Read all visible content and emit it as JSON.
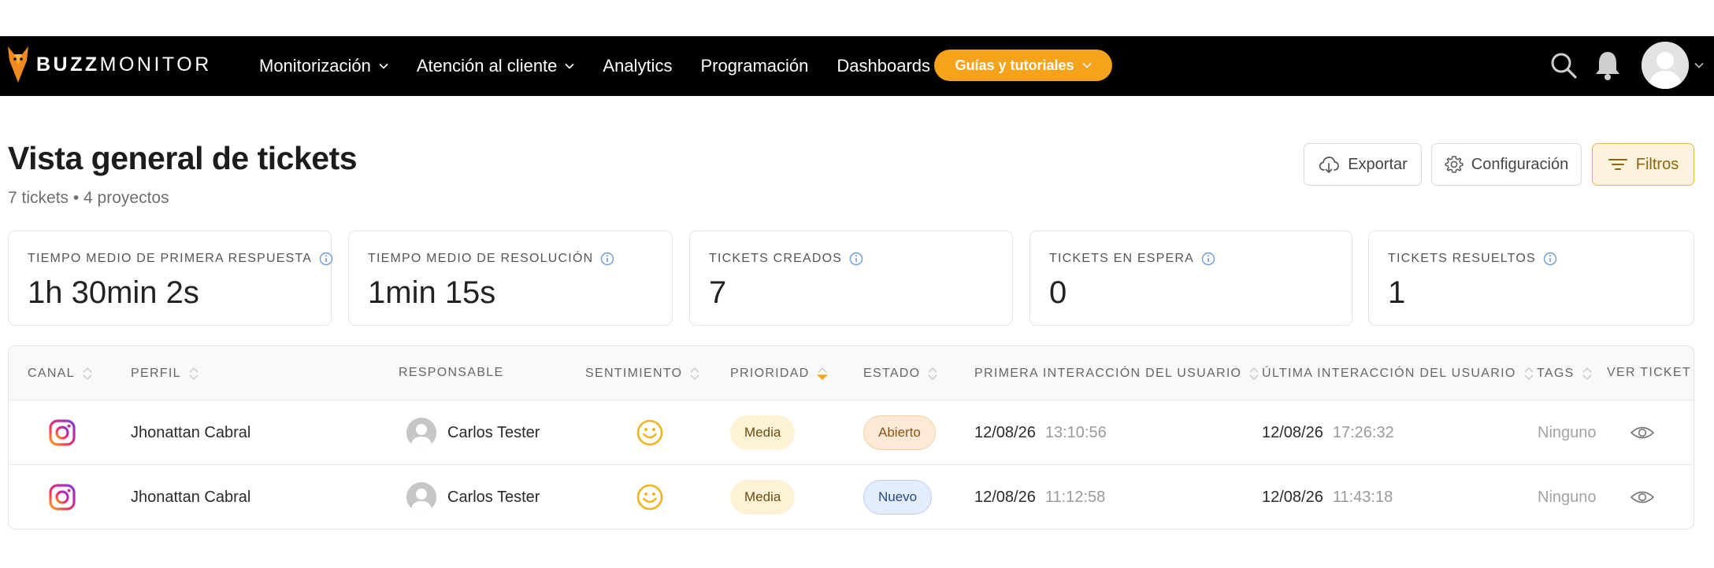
{
  "brand": {
    "bold": "BUZZ",
    "light": "MONITOR"
  },
  "nav": {
    "items": [
      {
        "label": "Monitorización",
        "has_dropdown": true
      },
      {
        "label": "Atención al cliente",
        "has_dropdown": true
      },
      {
        "label": "Analytics",
        "has_dropdown": false
      },
      {
        "label": "Programación",
        "has_dropdown": false
      },
      {
        "label": "Dashboards",
        "has_dropdown": false
      }
    ],
    "guides_label": "Guías y tutoriales",
    "icons": [
      "search-icon",
      "bell-icon",
      "user-avatar",
      "chevron-down-icon"
    ]
  },
  "header": {
    "title": "Vista general de tickets",
    "subtitle": "7 tickets • 4 proyectos",
    "buttons": {
      "export": "Exportar",
      "config": "Configuración",
      "filters": "Filtros"
    }
  },
  "stats": [
    {
      "label": "TIEMPO MEDIO DE PRIMERA RESPUESTA",
      "value": "1h 30min 2s"
    },
    {
      "label": "TIEMPO MEDIO DE RESOLUCIÓN",
      "value": "1min 15s"
    },
    {
      "label": "TICKETS CREADOS",
      "value": "7"
    },
    {
      "label": "TICKETS EN ESPERA",
      "value": "0"
    },
    {
      "label": "TICKETS RESUELTOS",
      "value": "1"
    }
  ],
  "table": {
    "columns": [
      "CANAL",
      "PERFIL",
      "RESPONSABLE",
      "SENTIMIENTO",
      "PRIORIDAD",
      "ESTADO",
      "PRIMERA INTERACCIÓN DEL USUARIO",
      "ÚLTIMA INTERACCIÓN DEL USUARIO",
      "TAGS",
      "VER TICKET"
    ],
    "active_sort_column": "PRIORIDAD",
    "rows": [
      {
        "channel": "instagram-icon",
        "profile": "Jhonattan Cabral",
        "agent": "Carlos Tester",
        "sentiment": "smile-icon",
        "priority": "Media",
        "status": "Abierto",
        "first_date": "12/08/26",
        "first_time": "13:10:56",
        "last_date": "12/08/26",
        "last_time": "17:26:32",
        "tags": "Ninguno"
      },
      {
        "channel": "instagram-icon",
        "profile": "Jhonattan Cabral",
        "agent": "Carlos Tester",
        "sentiment": "smile-icon",
        "priority": "Media",
        "status": "Nuevo",
        "first_date": "12/08/26",
        "first_time": "11:12:58",
        "last_date": "12/08/26",
        "last_time": "11:43:18",
        "tags": "Ninguno"
      }
    ]
  },
  "colors": {
    "accent": "#f6a31b",
    "navbar": "#000000",
    "info": "#6b9bd9"
  }
}
